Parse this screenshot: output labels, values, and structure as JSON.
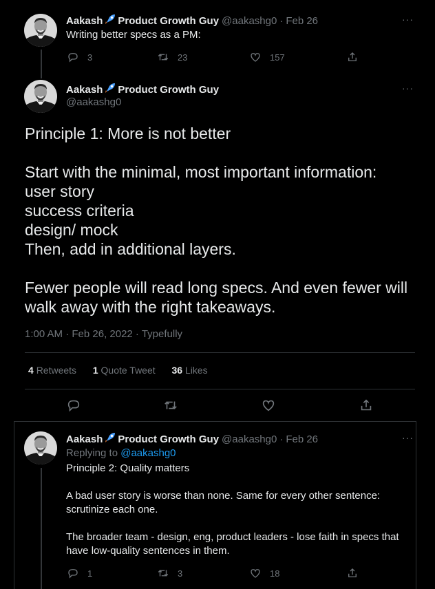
{
  "tweet1": {
    "author": "Aakash",
    "author_suffix": "Product Growth Guy",
    "handle": "@aakashg0",
    "date": "Feb 26",
    "text": "Writing better specs as a PM:",
    "replies": "3",
    "retweets": "23",
    "likes": "157"
  },
  "main_tweet": {
    "author": "Aakash",
    "author_suffix": "Product Growth Guy",
    "handle": "@aakashg0",
    "lines": [
      "Principle 1: More is not better",
      "Start with the minimal, most important information:",
      "user story",
      "success criteria",
      "design/ mock",
      "Then, add in additional layers.",
      "Fewer people will read long specs.  And even fewer will",
      "walk away with the right takeaways."
    ],
    "meta": "1:00 AM · Feb 26, 2022 · Typefully",
    "stats": {
      "retweets_num": "4",
      "retweets_label": "Retweets",
      "quotes_num": "1",
      "quotes_label": "Quote Tweet",
      "likes_num": "36",
      "likes_label": "Likes"
    }
  },
  "reply": {
    "author": "Aakash",
    "author_suffix": "Product Growth Guy",
    "handle": "@aakashg0",
    "date": "Feb 26",
    "replying_prefix": "Replying to",
    "replying_handle": "@aakashg0",
    "lines": [
      "Principle 2: Quality matters",
      "A bad user story is worse than none. Same for every other sentence:",
      "scrutinize each one.",
      "The broader team - design, eng, product leaders - lose faith in specs that",
      "have low-quality sentences in them."
    ],
    "replies": "1",
    "retweets": "3",
    "likes": "18"
  },
  "more_icon": "···",
  "separator": "·"
}
